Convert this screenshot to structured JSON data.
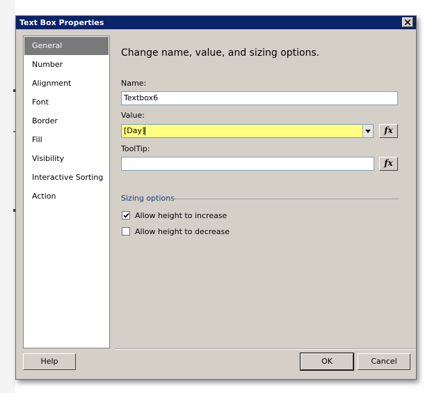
{
  "dialog": {
    "title": "Text Box Properties",
    "heading": "Change name, value, and sizing options."
  },
  "nav": {
    "items": [
      {
        "label": "General",
        "selected": true
      },
      {
        "label": "Number"
      },
      {
        "label": "Alignment"
      },
      {
        "label": "Font"
      },
      {
        "label": "Border"
      },
      {
        "label": "Fill"
      },
      {
        "label": "Visibility"
      },
      {
        "label": "Interactive Sorting"
      },
      {
        "label": "Action"
      }
    ]
  },
  "form": {
    "name_label": "Name:",
    "name_value": "Textbox6",
    "value_label": "Value:",
    "value_value": "[Day]",
    "tooltip_label": "ToolTip:",
    "tooltip_value": "",
    "fx_label": "fx"
  },
  "sizing": {
    "title": "Sizing options",
    "options": [
      {
        "label": "Allow height to increase",
        "checked": true
      },
      {
        "label": "Allow height to decrease",
        "checked": false
      }
    ]
  },
  "buttons": {
    "help": "Help",
    "ok": "OK",
    "cancel": "Cancel"
  },
  "colors": {
    "title_bar": "#0a246a",
    "dialog_bg": "#d4d0c8",
    "value_highlight": "#ffff80",
    "nav_selected": "#7a7a7a"
  }
}
